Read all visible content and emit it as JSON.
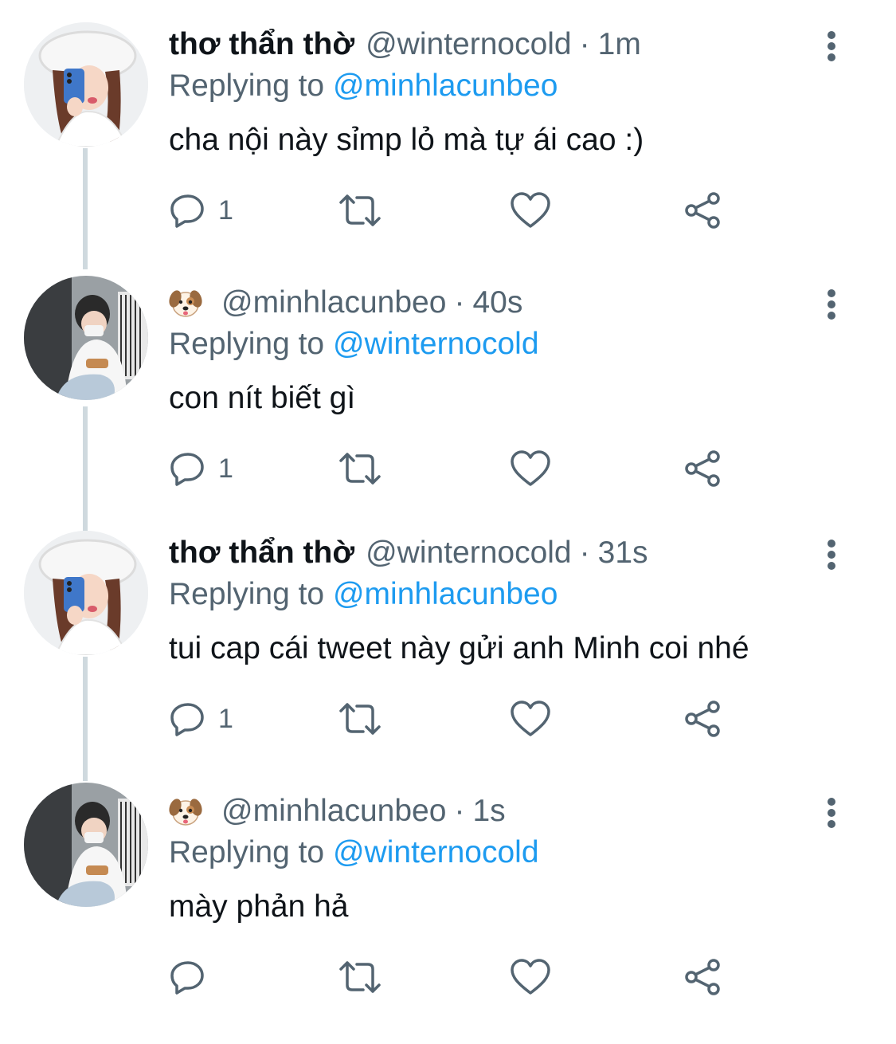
{
  "tweets": [
    {
      "display_name": "thơ thẩn thờ",
      "has_emoji_name": false,
      "handle": "@winternocold",
      "separator": "·",
      "time": "1m",
      "replying_prefix": "Replying to",
      "replying_to": "@minhlacunbeo",
      "text": "cha nội này sỉmp lỏ mà tự ái cao :)",
      "reply_count": "1",
      "avatar": "girl-avatar"
    },
    {
      "display_name": "",
      "has_emoji_name": true,
      "emoji_icon": "dog-face-icon",
      "handle": "@minhlacunbeo",
      "separator": "·",
      "time": "40s",
      "replying_prefix": "Replying to",
      "replying_to": "@winternocold",
      "text": "con nít biết gì",
      "reply_count": "1",
      "avatar": "boy-avatar"
    },
    {
      "display_name": "thơ thẩn thờ",
      "has_emoji_name": false,
      "handle": "@winternocold",
      "separator": "·",
      "time": "31s",
      "replying_prefix": "Replying to",
      "replying_to": "@minhlacunbeo",
      "text": "tui cap cái tweet này gửi anh Minh coi nhé",
      "reply_count": "1",
      "avatar": "girl-avatar"
    },
    {
      "display_name": "",
      "has_emoji_name": true,
      "emoji_icon": "dog-face-icon",
      "handle": "@minhlacunbeo",
      "separator": "·",
      "time": "1s",
      "replying_prefix": "Replying to",
      "replying_to": "@winternocold",
      "text": "mày phản hả",
      "reply_count": "",
      "avatar": "boy-avatar"
    }
  ],
  "colors": {
    "text": "#0f1419",
    "secondary": "#536471",
    "link": "#1d9bf0",
    "thread_line": "#cfd9de"
  }
}
